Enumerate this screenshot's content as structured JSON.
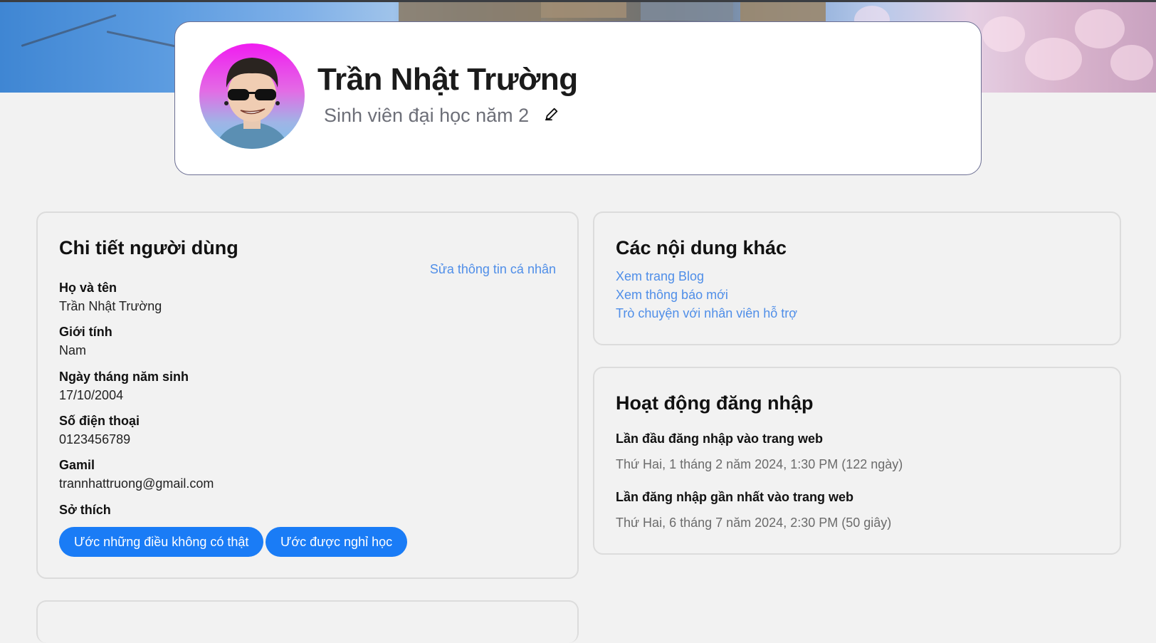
{
  "profile": {
    "name": "Trần Nhật Trường",
    "subtitle": "Sinh viên đại học năm 2",
    "edit_icon": "pencil-icon"
  },
  "user_details": {
    "title": "Chi tiết người dùng",
    "edit_link": "Sửa thông tin cá nhân",
    "fields": [
      {
        "label": "Họ và tên",
        "value": "Trần Nhật Trường"
      },
      {
        "label": "Giới tính",
        "value": "Nam"
      },
      {
        "label": "Ngày tháng năm sinh",
        "value": "17/10/2004"
      },
      {
        "label": "Số điện thoại",
        "value": "0123456789"
      },
      {
        "label": "Gamil",
        "value": "trannhattruong@gmail.com"
      }
    ],
    "hobbies_label": "Sở thích",
    "hobbies": [
      "Ước những điều không có thật",
      "Ước được nghỉ học"
    ]
  },
  "other_content": {
    "title": "Các nội dung khác",
    "links": [
      "Xem trang Blog",
      "Xem thông báo mới",
      "Trò chuyện với nhân viên hỗ trợ"
    ]
  },
  "login_activity": {
    "title": "Hoạt động đăng nhập",
    "first_label": "Lần đầu đăng nhập vào trang web",
    "first_value": "Thứ Hai, 1 tháng 2 năm 2024, 1:30 PM (122 ngày)",
    "last_label": "Lần đăng nhập gần nhất vào trang web",
    "last_value": "Thứ Hai, 6 tháng 7 năm 2024, 2:30 PM (50 giây)"
  },
  "colors": {
    "accent": "#1a7cf6",
    "link": "#4f8ee8",
    "profile_border": "#6c6f93",
    "page_background": "#f2f2f2"
  }
}
